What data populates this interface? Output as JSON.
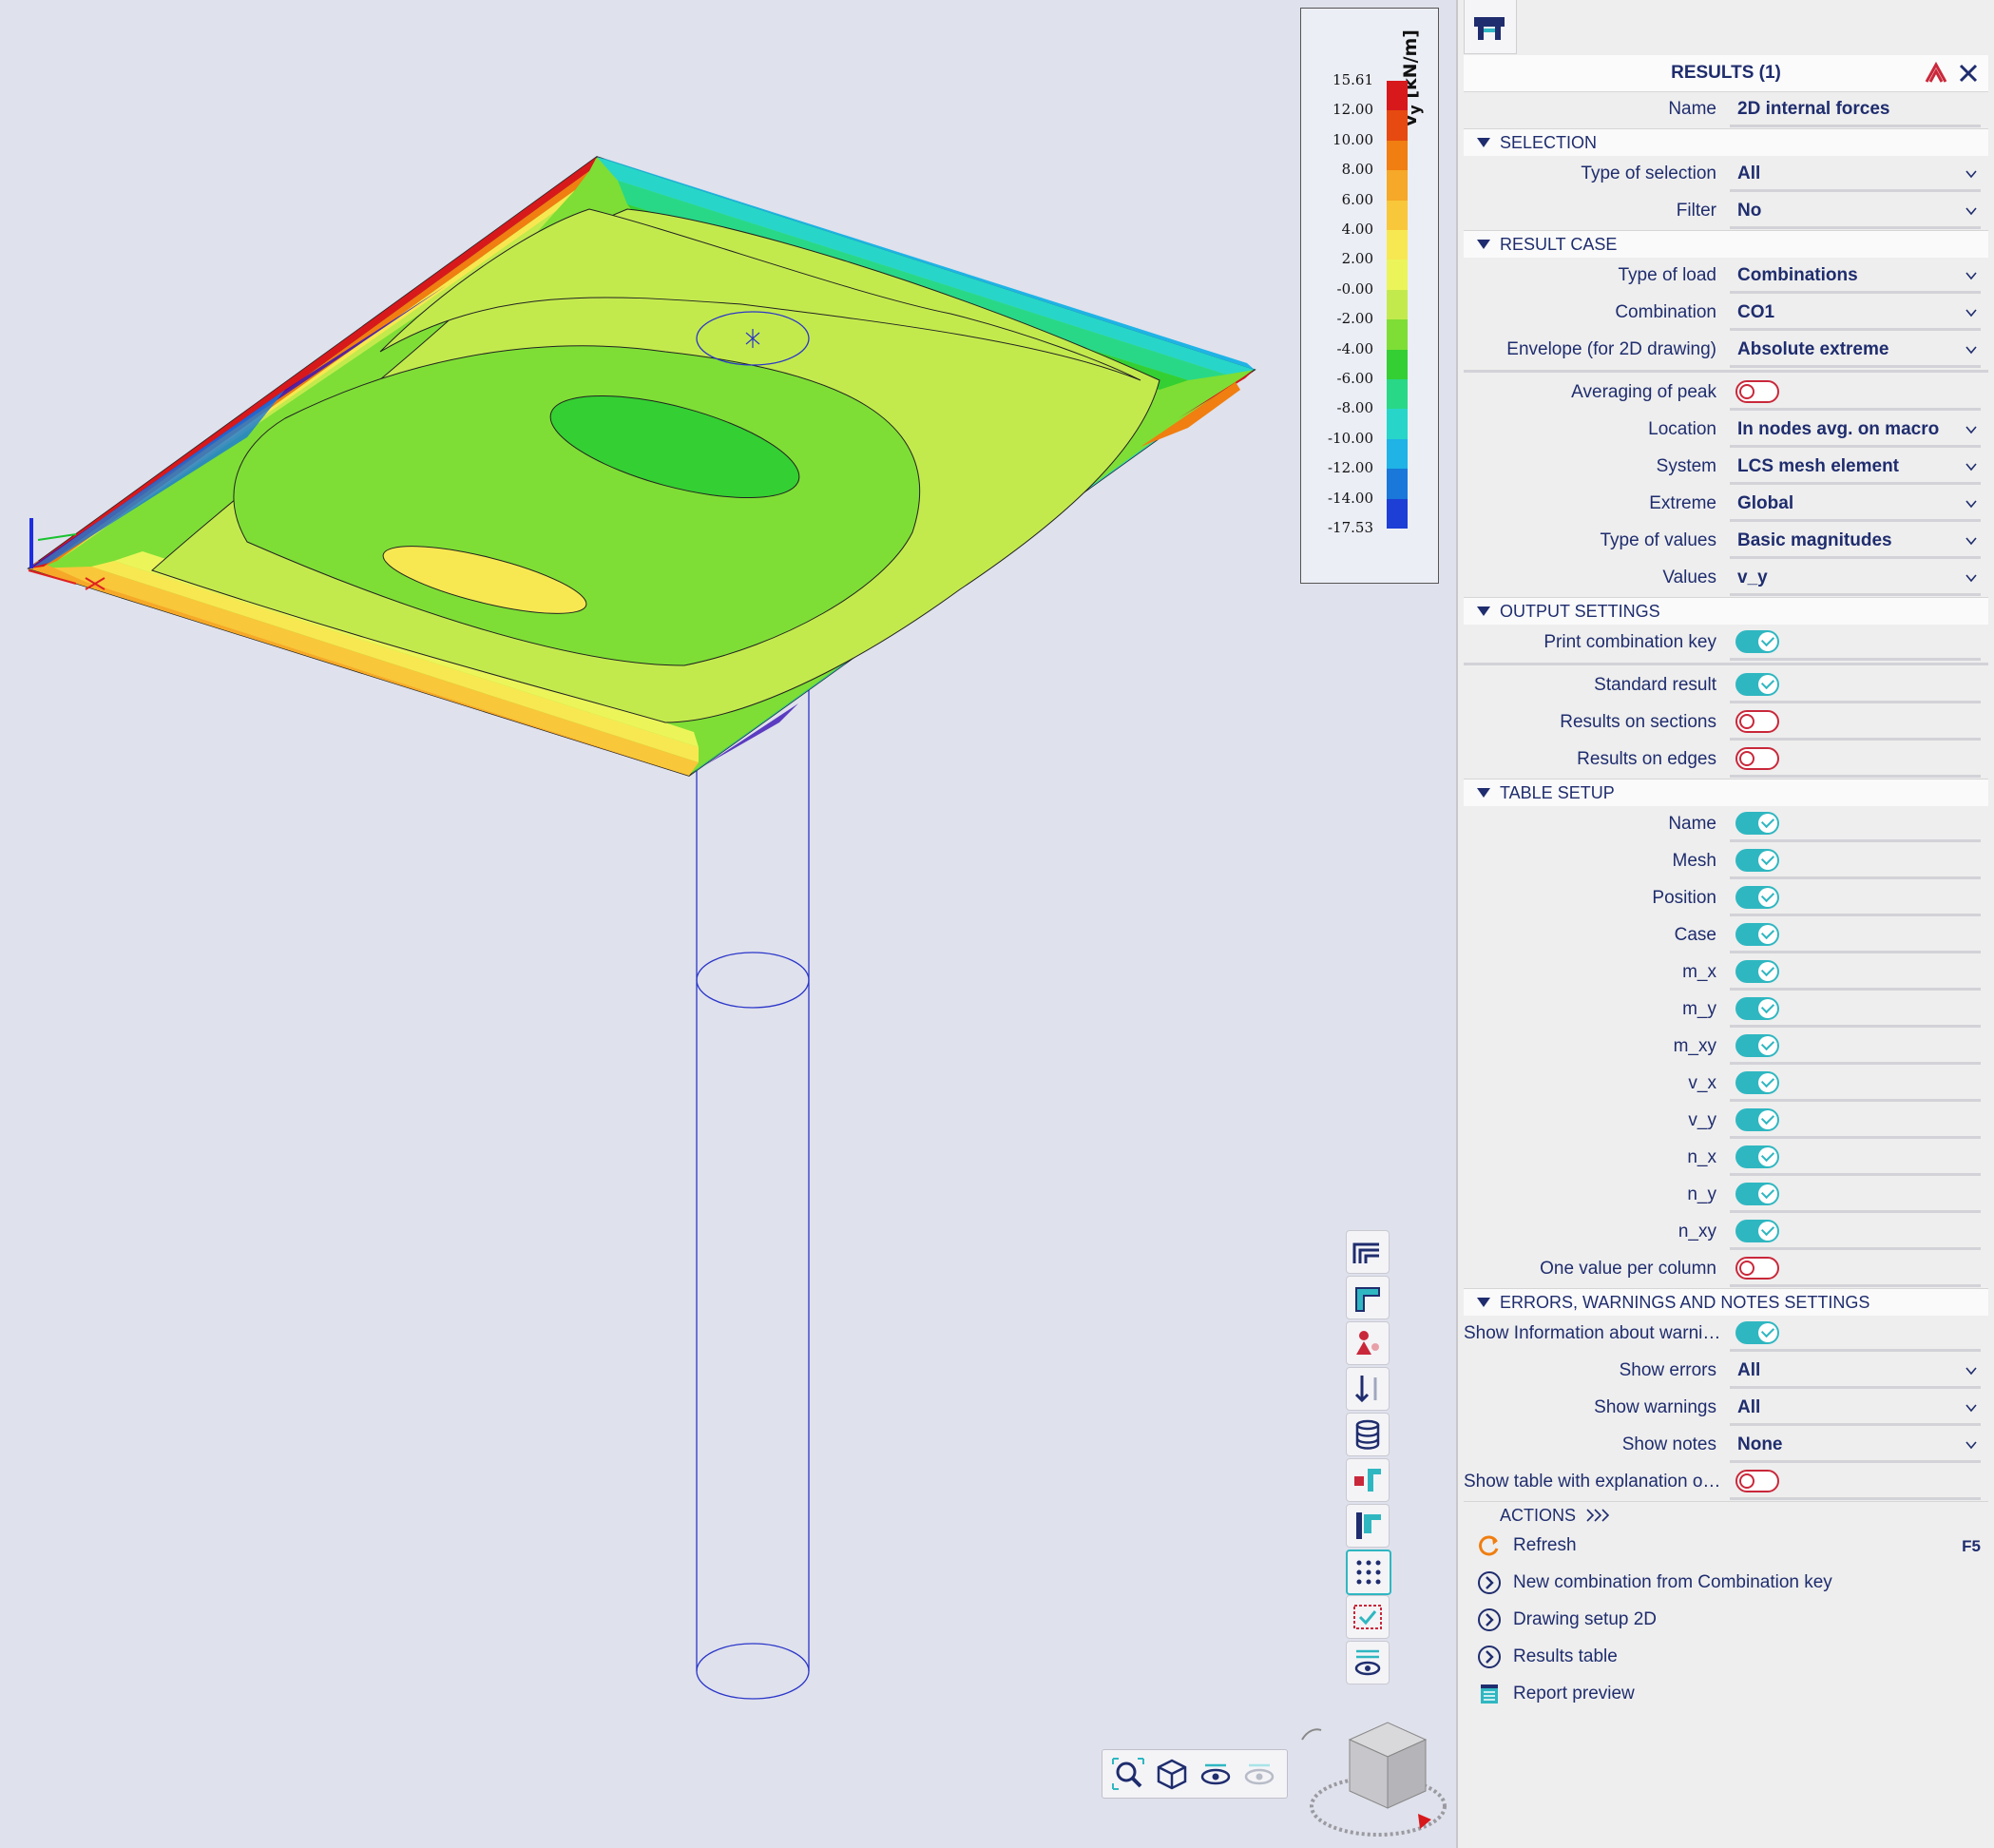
{
  "legend": {
    "title": "v",
    "subscript": "y",
    "unit": "[kN/m]",
    "values": [
      "15.61",
      "12.00",
      "10.00",
      "8.00",
      "6.00",
      "4.00",
      "2.00",
      "-0.00",
      "-2.00",
      "-4.00",
      "-6.00",
      "-8.00",
      "-10.00",
      "-12.00",
      "-14.00",
      "-17.53"
    ],
    "colors": [
      "#d7191c",
      "#e64a10",
      "#f07e10",
      "#f6a828",
      "#f8c73a",
      "#f7e851",
      "#ebf55a",
      "#c3ea4d",
      "#7ede35",
      "#34cf32",
      "#28d887",
      "#27d6c8",
      "#1fb3e6",
      "#1978d9",
      "#1d3fd6",
      "#3913b6"
    ]
  },
  "panel": {
    "title": "RESULTS (1)",
    "name": {
      "label": "Name",
      "value": "2D internal forces"
    },
    "sections": {
      "selection": "SELECTION",
      "result_case": "RESULT CASE",
      "output": "OUTPUT SETTINGS",
      "table": "TABLE SETUP",
      "errors": "ERRORS, WARNINGS AND NOTES SETTINGS",
      "actions": "ACTIONS"
    },
    "selection": [
      {
        "label": "Type of selection",
        "value": "All"
      },
      {
        "label": "Filter",
        "value": "No"
      }
    ],
    "result_case": [
      {
        "label": "Type of load",
        "value": "Combinations"
      },
      {
        "label": "Combination",
        "value": "CO1"
      },
      {
        "label": "Envelope (for 2D drawing)",
        "value": "Absolute extreme"
      }
    ],
    "averaging": {
      "label": "Averaging of peak",
      "on": false
    },
    "result_params": [
      {
        "label": "Location",
        "value": "In nodes avg. on macro"
      },
      {
        "label": "System",
        "value": "LCS mesh element"
      },
      {
        "label": "Extreme",
        "value": "Global"
      },
      {
        "label": "Type of values",
        "value": "Basic magnitudes"
      },
      {
        "label": "Values",
        "value": "v_y"
      }
    ],
    "print_key": {
      "label": "Print combination key",
      "on": true
    },
    "output_toggles": [
      {
        "label": "Standard result",
        "on": true
      },
      {
        "label": "Results on sections",
        "on": false
      },
      {
        "label": "Results on edges",
        "on": false
      }
    ],
    "table_setup": [
      {
        "label": "Name",
        "on": true
      },
      {
        "label": "Mesh",
        "on": true
      },
      {
        "label": "Position",
        "on": true
      },
      {
        "label": "Case",
        "on": true
      },
      {
        "label": "m_x",
        "on": true
      },
      {
        "label": "m_y",
        "on": true
      },
      {
        "label": "m_xy",
        "on": true
      },
      {
        "label": "v_x",
        "on": true
      },
      {
        "label": "v_y",
        "on": true
      },
      {
        "label": "n_x",
        "on": true
      },
      {
        "label": "n_y",
        "on": true
      },
      {
        "label": "n_xy",
        "on": true
      },
      {
        "label": "One value per column",
        "on": false
      }
    ],
    "show_info": {
      "label": "Show Information about warni…",
      "on": true
    },
    "show_lists": [
      {
        "label": "Show errors",
        "value": "All"
      },
      {
        "label": "Show warnings",
        "value": "All"
      },
      {
        "label": "Show notes",
        "value": "None"
      }
    ],
    "show_table": {
      "label": "Show table with explanation o…",
      "on": false
    },
    "actions": [
      {
        "label": "Refresh",
        "key": "F5",
        "icon": "refresh-icon"
      },
      {
        "label": "New combination from Combination key",
        "key": "",
        "icon": "arrow-circle-icon"
      },
      {
        "label": "Drawing setup 2D",
        "key": "",
        "icon": "arrow-circle-icon"
      },
      {
        "label": "Results table",
        "key": "",
        "icon": "arrow-circle-icon"
      },
      {
        "label": "Report preview",
        "key": "",
        "icon": "report-icon"
      }
    ]
  },
  "toolbar_icons": [
    "structure-icon",
    "section-icon",
    "load-icon",
    "support-icon",
    "database-icon",
    "node-icon",
    "member-icon",
    "mesh-points-icon",
    "selection-icon",
    "visibility-icon"
  ],
  "view_icons": [
    "zoom-icon",
    "cube-view-icon",
    "eye-icon",
    "eye-hidden-icon"
  ]
}
